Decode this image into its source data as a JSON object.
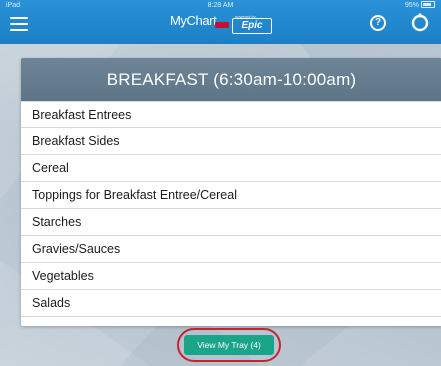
{
  "status_bar": {
    "carrier": "iPad",
    "time": "8:28 AM",
    "battery": "95%"
  },
  "header": {
    "app_name": "MyChart",
    "powered_by": "powered by",
    "vendor": "Epic",
    "menu_icon": "hamburger-menu-icon",
    "help_icon": "question-circle-icon",
    "help_glyph": "?",
    "settings_icon": "ring-settings-icon",
    "brand_color": "#1c7fc6"
  },
  "menu": {
    "title": "BREAKFAST (6:30am-10:00am)",
    "items": [
      "Breakfast Entrees",
      "Breakfast Sides",
      "Cereal",
      "Toppings for Breakfast Entree/Cereal",
      "Starches",
      "Gravies/Sauces",
      "Vegetables",
      "Salads"
    ]
  },
  "tray": {
    "button_label": "View My Tray (4)",
    "button_color": "#1aa489",
    "highlight_color": "#c8232c"
  }
}
